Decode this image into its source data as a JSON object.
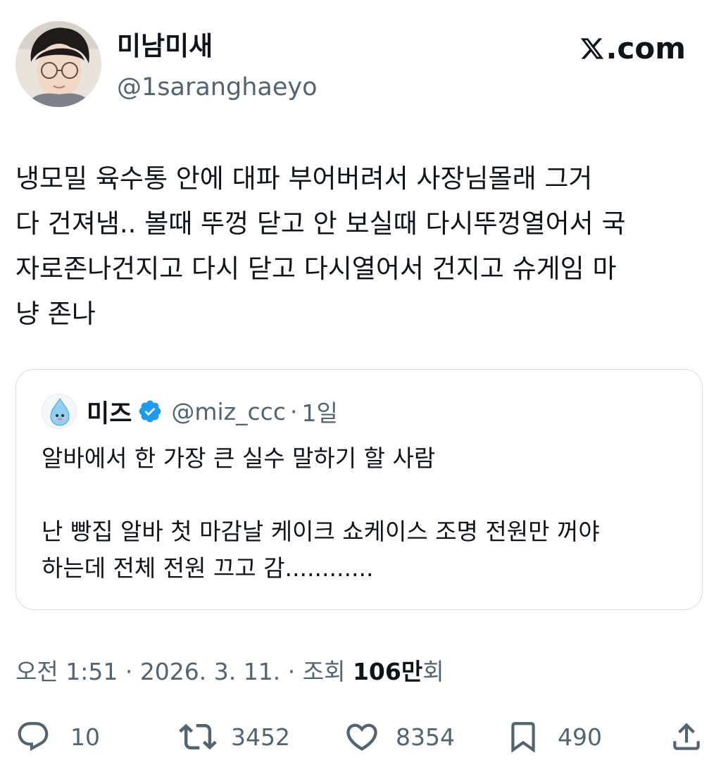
{
  "author": {
    "display_name": "미남미새",
    "handle": "@1saranghaeyo"
  },
  "brand": {
    "label": ".com"
  },
  "tweet": {
    "text": "냉모밀 육수통 안에 대파 부어버려서 사장님몰래 그거\n다 건져냄.. 볼때 뚜껑 닫고 안 보실때 다시뚜껑열어서 국\n자로존나건지고 다시 닫고 다시열어서 건지고 슈게임 마\n냥 존나"
  },
  "quote": {
    "name": "미즈",
    "handle": "@miz_ccc",
    "separator": "·",
    "time": "1일",
    "text": "알바에서 한 가장 큰 실수 말하기 할 사람\n\n난 빵집 알바 첫 마감날 케이크 쇼케이스 조명 전원만 꺼야\n하는데 전체 전원 끄고 감............"
  },
  "meta": {
    "time": "오전 1:51",
    "sep1": " · ",
    "date": "2026. 3. 11.",
    "sep2": " · ",
    "views_label": "조회 ",
    "views_count": "106만",
    "views_suffix": "회"
  },
  "actions": {
    "replies": "10",
    "retweets": "3452",
    "likes": "8354",
    "bookmarks": "490"
  },
  "colors": {
    "text_primary": "#0f1419",
    "text_secondary": "#536471",
    "verified_blue": "#1d9bf0",
    "border": "#d9dee2"
  },
  "icons": [
    "x-logo-icon",
    "verified-badge-icon",
    "reply-icon",
    "retweet-icon",
    "like-icon",
    "bookmark-icon",
    "share-icon"
  ]
}
